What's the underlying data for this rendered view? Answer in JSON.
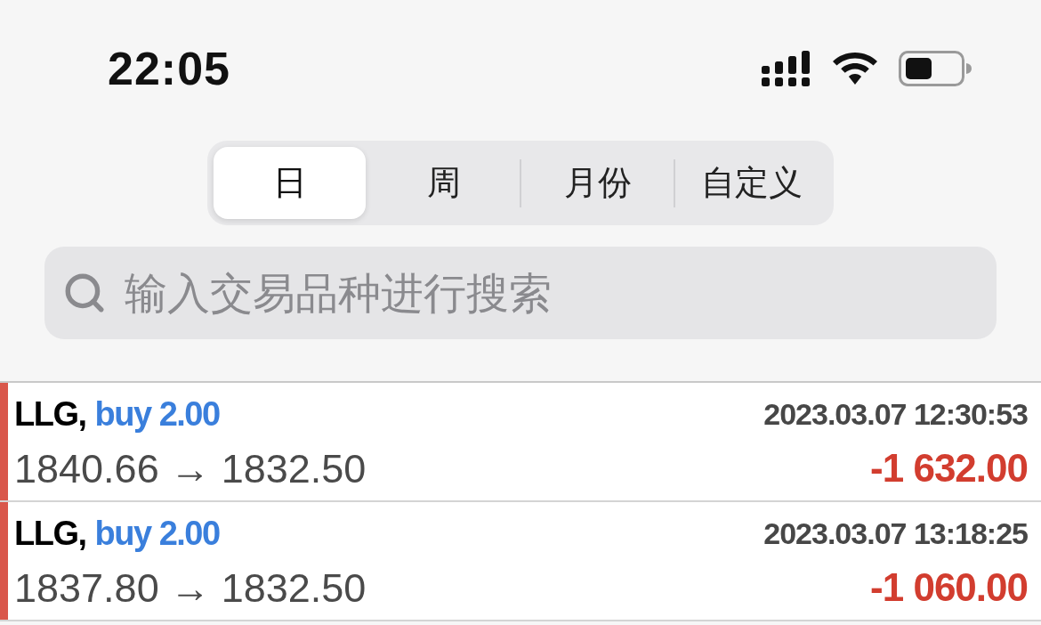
{
  "status_bar": {
    "time": "22:05"
  },
  "period_tabs": [
    {
      "label": "日",
      "selected": true
    },
    {
      "label": "周",
      "selected": false
    },
    {
      "label": "月份",
      "selected": false
    },
    {
      "label": "自定义",
      "selected": false
    }
  ],
  "search": {
    "placeholder": "输入交易品种进行搜索"
  },
  "trades": [
    {
      "symbol": "LLG,",
      "order": "buy 2.00",
      "prices": "1840.66 → 1832.50",
      "time": "2023.03.07 12:30:53",
      "profit": "-1 632.00",
      "loss": true
    },
    {
      "symbol": "LLG,",
      "order": "buy 2.00",
      "prices": "1837.80 → 1832.50",
      "time": "2023.03.07 13:18:25",
      "profit": "-1 060.00",
      "loss": true
    }
  ]
}
